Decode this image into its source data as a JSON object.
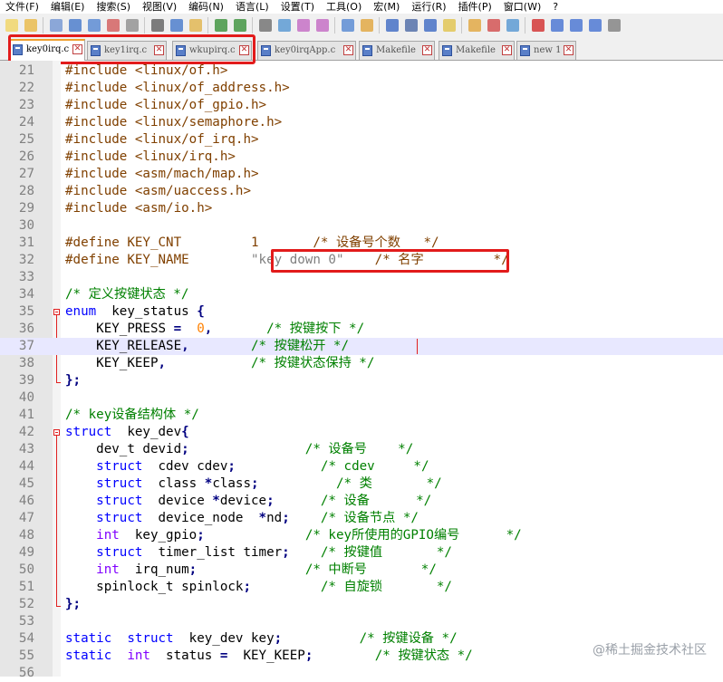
{
  "menu": [
    "文件(F)",
    "编辑(E)",
    "搜索(S)",
    "视图(V)",
    "编码(N)",
    "语言(L)",
    "设置(T)",
    "工具(O)",
    "宏(M)",
    "运行(R)",
    "插件(P)",
    "窗口(W)",
    "?"
  ],
  "tabs": [
    {
      "label": "key0irq.c",
      "active": true
    },
    {
      "label": "key1irq.c",
      "active": false
    },
    {
      "label": "wkupirq.c",
      "active": false
    },
    {
      "label": "key0irqApp.c",
      "active": false
    },
    {
      "label": "Makefile",
      "active": false
    },
    {
      "label": "Makefile",
      "active": false
    },
    {
      "label": "new 1",
      "active": false
    }
  ],
  "close_glyph": "✕",
  "watermark": "@稀土掘金技术社区",
  "lines": [
    {
      "n": "21",
      "tokens": [
        [
          "pp",
          "#include <linux/of.h>"
        ]
      ]
    },
    {
      "n": "22",
      "tokens": [
        [
          "pp",
          "#include <linux/of_address.h>"
        ]
      ]
    },
    {
      "n": "23",
      "tokens": [
        [
          "pp",
          "#include <linux/of_gpio.h>"
        ]
      ]
    },
    {
      "n": "24",
      "tokens": [
        [
          "pp",
          "#include <linux/semaphore.h>"
        ]
      ]
    },
    {
      "n": "25",
      "tokens": [
        [
          "pp",
          "#include <linux/of_irq.h>"
        ]
      ]
    },
    {
      "n": "26",
      "tokens": [
        [
          "pp",
          "#include <linux/irq.h>"
        ]
      ]
    },
    {
      "n": "27",
      "tokens": [
        [
          "pp",
          "#include <asm/mach/map.h>"
        ]
      ]
    },
    {
      "n": "28",
      "tokens": [
        [
          "pp",
          "#include <asm/uaccess.h>"
        ]
      ]
    },
    {
      "n": "29",
      "tokens": [
        [
          "pp",
          "#include <asm/io.h>"
        ]
      ]
    },
    {
      "n": "30",
      "tokens": []
    },
    {
      "n": "31",
      "tokens": [
        [
          "pp",
          "#define KEY_CNT         1       /* 设备号个数   */"
        ]
      ]
    },
    {
      "n": "32",
      "tokens": [
        [
          "pp",
          "#define KEY_NAME        "
        ],
        [
          "str",
          "\"key down 0\""
        ],
        [
          "pp",
          "    /* 名字         */"
        ]
      ]
    },
    {
      "n": "33",
      "tokens": []
    },
    {
      "n": "34",
      "tokens": [
        [
          "cm",
          "/* 定义按键状态 */"
        ]
      ]
    },
    {
      "n": "35",
      "tokens": [
        [
          "kw",
          "enum"
        ],
        [
          "",
          "  key_status "
        ],
        [
          "op",
          "{"
        ]
      ]
    },
    {
      "n": "36",
      "tokens": [
        [
          "",
          "    KEY_PRESS "
        ],
        [
          "op",
          "="
        ],
        [
          "",
          "  "
        ],
        [
          "num",
          "0"
        ],
        [
          "op",
          ","
        ],
        [
          "",
          "       "
        ],
        [
          "cm",
          "/* 按键按下 */"
        ]
      ]
    },
    {
      "n": "37",
      "tokens": [
        [
          "",
          "    KEY_RELEASE"
        ],
        [
          "op",
          ","
        ],
        [
          "",
          "        "
        ],
        [
          "cm",
          "/* 按键松开 */"
        ]
      ],
      "current": true
    },
    {
      "n": "38",
      "tokens": [
        [
          "",
          "    KEY_KEEP"
        ],
        [
          "op",
          ","
        ],
        [
          "",
          "           "
        ],
        [
          "cm",
          "/* 按键状态保持 */"
        ]
      ]
    },
    {
      "n": "39",
      "tokens": [
        [
          "op",
          "};"
        ]
      ]
    },
    {
      "n": "40",
      "tokens": []
    },
    {
      "n": "41",
      "tokens": [
        [
          "cm",
          "/* key设备结构体 */"
        ]
      ]
    },
    {
      "n": "42",
      "tokens": [
        [
          "kw",
          "struct"
        ],
        [
          "",
          "  key_dev"
        ],
        [
          "op",
          "{"
        ]
      ]
    },
    {
      "n": "43",
      "tokens": [
        [
          "",
          "    dev_t devid"
        ],
        [
          "op",
          ";"
        ],
        [
          "",
          "               "
        ],
        [
          "cm",
          "/* 设备号    */"
        ]
      ]
    },
    {
      "n": "44",
      "tokens": [
        [
          "kw",
          "    struct"
        ],
        [
          "",
          "  cdev cdev"
        ],
        [
          "op",
          ";"
        ],
        [
          "",
          "           "
        ],
        [
          "cm",
          "/* cdev     */"
        ]
      ]
    },
    {
      "n": "45",
      "tokens": [
        [
          "kw",
          "    struct"
        ],
        [
          "",
          "  class "
        ],
        [
          "op",
          "*"
        ],
        [
          "",
          "class"
        ],
        [
          "op",
          ";"
        ],
        [
          "",
          "          "
        ],
        [
          "cm",
          "/* 类       */"
        ]
      ]
    },
    {
      "n": "46",
      "tokens": [
        [
          "kw",
          "    struct"
        ],
        [
          "",
          "  device "
        ],
        [
          "op",
          "*"
        ],
        [
          "",
          "device"
        ],
        [
          "op",
          ";"
        ],
        [
          "",
          "      "
        ],
        [
          "cm",
          "/* 设备      */"
        ]
      ]
    },
    {
      "n": "47",
      "tokens": [
        [
          "kw",
          "    struct"
        ],
        [
          "",
          "  device_node  "
        ],
        [
          "op",
          "*"
        ],
        [
          "",
          "nd"
        ],
        [
          "op",
          ";"
        ],
        [
          "",
          "    "
        ],
        [
          "cm",
          "/* 设备节点 */"
        ]
      ]
    },
    {
      "n": "48",
      "tokens": [
        [
          "kw2",
          "    int"
        ],
        [
          "",
          "  key_gpio"
        ],
        [
          "op",
          ";"
        ],
        [
          "",
          "             "
        ],
        [
          "cm",
          "/* key所使用的GPIO编号      */"
        ]
      ]
    },
    {
      "n": "49",
      "tokens": [
        [
          "kw",
          "    struct"
        ],
        [
          "",
          "  timer_list timer"
        ],
        [
          "op",
          ";"
        ],
        [
          "",
          "    "
        ],
        [
          "cm",
          "/* 按键值       */"
        ]
      ]
    },
    {
      "n": "50",
      "tokens": [
        [
          "kw2",
          "    int"
        ],
        [
          "",
          "  irq_num"
        ],
        [
          "op",
          ";"
        ],
        [
          "",
          "              "
        ],
        [
          "cm",
          "/* 中断号       */"
        ]
      ]
    },
    {
      "n": "51",
      "tokens": [
        [
          "",
          "    spinlock_t spinlock"
        ],
        [
          "op",
          ";"
        ],
        [
          "",
          "         "
        ],
        [
          "cm",
          "/* 自旋锁       */"
        ]
      ]
    },
    {
      "n": "52",
      "tokens": [
        [
          "op",
          "};"
        ]
      ]
    },
    {
      "n": "53",
      "tokens": []
    },
    {
      "n": "54",
      "tokens": [
        [
          "kw",
          "static"
        ],
        [
          "",
          ""
        ],
        [
          "kw",
          "  struct"
        ],
        [
          "",
          "  key_dev key"
        ],
        [
          "op",
          ";"
        ],
        [
          "",
          "          "
        ],
        [
          "cm",
          "/* 按键设备 */"
        ]
      ]
    },
    {
      "n": "55",
      "tokens": [
        [
          "kw",
          "static"
        ],
        [
          "",
          ""
        ],
        [
          "kw2",
          "  int"
        ],
        [
          "",
          "  status "
        ],
        [
          "op",
          "="
        ],
        [
          "",
          "  KEY_KEEP"
        ],
        [
          "op",
          ";"
        ],
        [
          "",
          "        "
        ],
        [
          "cm",
          "/* 按键状态 */"
        ]
      ]
    },
    {
      "n": "56",
      "tokens": []
    }
  ]
}
